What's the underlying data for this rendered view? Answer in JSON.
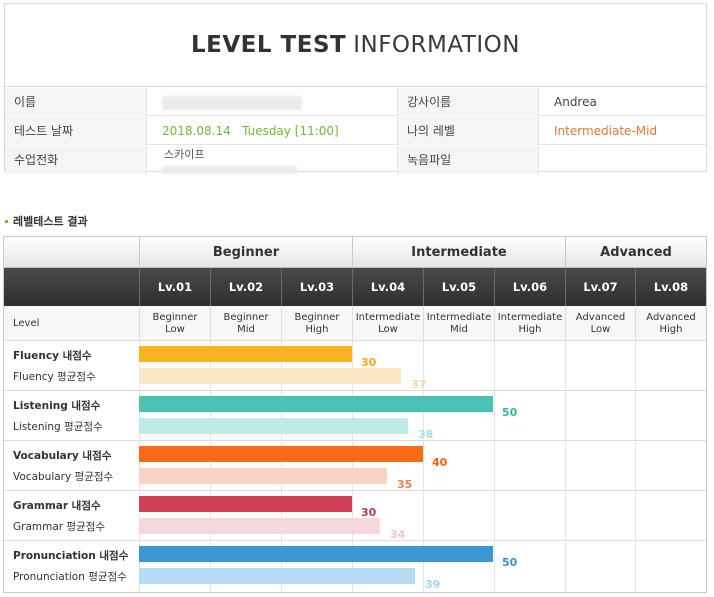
{
  "info": {
    "title_bold": "LEVEL TEST",
    "title_light": "INFORMATION",
    "rows": [
      {
        "label1": "이름",
        "value1": "",
        "label2": "강사이름",
        "value2": "Andrea"
      },
      {
        "label1": "테스트 날짜",
        "value1": "2018.08.14   Tuesday [11:00]",
        "label2": "나의 레벨",
        "value2": "Intermediate-Mid"
      },
      {
        "label1": "수업전화",
        "value1": "스카이프",
        "label2": "녹음파일",
        "value2": ""
      }
    ],
    "colors": {
      "date": "#70b93a",
      "level": "#e0782d"
    }
  },
  "section_title": "레벨테스트 결과",
  "groups": [
    {
      "label": "Beginner"
    },
    {
      "label": "Intermediate"
    },
    {
      "label": "Advanced"
    }
  ],
  "levels": [
    "Lv.01",
    "Lv.02",
    "Lv.03",
    "Lv.04",
    "Lv.05",
    "Lv.06",
    "Lv.07",
    "Lv.08"
  ],
  "level_row_label": "Level",
  "level_names": [
    [
      "Beginner",
      "Low"
    ],
    [
      "Beginner",
      "Mid"
    ],
    [
      "Beginner",
      "High"
    ],
    [
      "Intermediate",
      "Low"
    ],
    [
      "Intermediate",
      "Mid"
    ],
    [
      "Intermediate",
      "High"
    ],
    [
      "Advanced",
      "Low"
    ],
    [
      "Advanced",
      "High"
    ]
  ],
  "chart_data": {
    "type": "bar",
    "title": "레벨테스트 결과",
    "orientation": "horizontal",
    "scale_max": 80,
    "categories": [
      "Fluency",
      "Listening",
      "Vocabulary",
      "Grammar",
      "Pronunciation"
    ],
    "series": [
      {
        "name": "내점수",
        "values": [
          30,
          50,
          40,
          30,
          50
        ]
      },
      {
        "name": "평균점수",
        "values": [
          37,
          38,
          35,
          34,
          39
        ]
      }
    ],
    "labels": [
      {
        "mine": "Fluency 내점수",
        "avg": "Fluency 평균점수"
      },
      {
        "mine": "Listening 내점수",
        "avg": "Listening 평균점수"
      },
      {
        "mine": "Vocabulary 내점수",
        "avg": "Vocabulary 평균점수"
      },
      {
        "mine": "Grammar 내점수",
        "avg": "Grammar 평균점수"
      },
      {
        "mine": "Pronunciation 내점수",
        "avg": "Pronunciation 평균점수"
      }
    ],
    "colors": [
      {
        "mine": "#f8b320",
        "avg": "#f9e6c4",
        "mine_text": "#f0a81c",
        "avg_text": "#f3d9a5"
      },
      {
        "mine": "#4ac3b4",
        "avg": "#bdebe5",
        "mine_text": "#3cb3a5",
        "avg_text": "#a9dfd8"
      },
      {
        "mine": "#fb6a14",
        "avg": "#f9d4c4",
        "mine_text": "#f0620f",
        "avg_text": "#e9874f"
      },
      {
        "mine": "#cf4058",
        "avg": "#f6d7dc",
        "mine_text": "#b93a50",
        "avg_text": "#f2c6cd"
      },
      {
        "mine": "#3a97d4",
        "avg": "#b3dcf5",
        "mine_text": "#3a8ec8",
        "avg_text": "#a8d4ef"
      }
    ]
  }
}
